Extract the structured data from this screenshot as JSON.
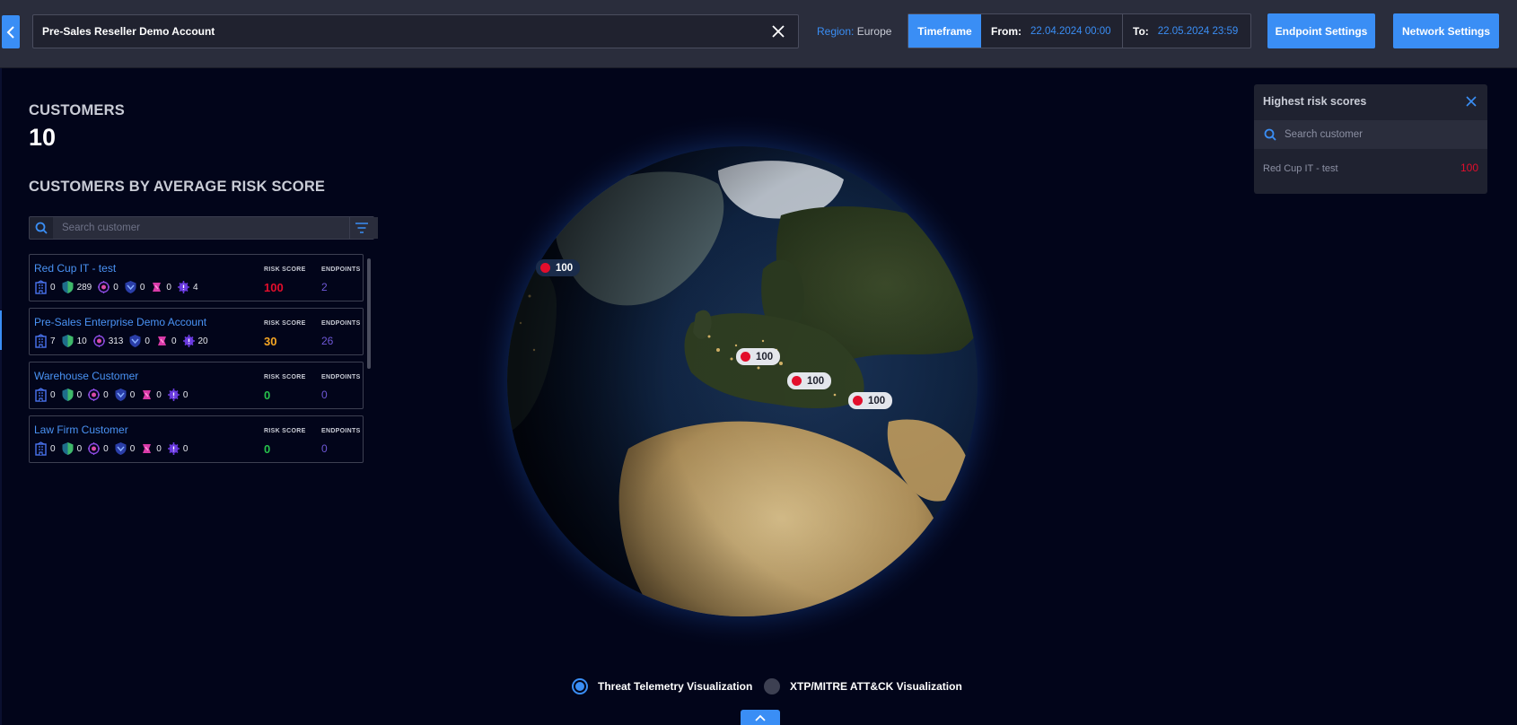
{
  "topbar": {
    "account_value": "Pre-Sales Reseller Demo Account",
    "region_label": "Region:",
    "region_value": "Europe",
    "timeframe_label": "Timeframe",
    "from_label": "From:",
    "from_value": "22.04.2024 00:00",
    "to_label": "To:",
    "to_value": "22.05.2024 23:59",
    "endpoint_settings": "Endpoint Settings",
    "network_settings": "Network Settings"
  },
  "summary": {
    "customers_label": "CUSTOMERS",
    "customers_count": "10",
    "avg_risk_label": "CUSTOMERS BY AVERAGE RISK SCORE"
  },
  "left_search": {
    "placeholder": "Search customer"
  },
  "customers": [
    {
      "name": "Red Cup IT - test",
      "risk_score_label": "RISK SCORE",
      "endpoints_label": "ENDPOINTS",
      "risk_score": "100",
      "risk_color": "#e30e2c",
      "endpoints": "2",
      "stats": [
        "0",
        "289",
        "0",
        "0",
        "0",
        "4"
      ]
    },
    {
      "name": "Pre-Sales Enterprise Demo Account",
      "risk_score_label": "RISK SCORE",
      "endpoints_label": "ENDPOINTS",
      "risk_score": "30",
      "risk_color": "#f5a623",
      "endpoints": "26",
      "stats": [
        "7",
        "10",
        "313",
        "0",
        "0",
        "20"
      ]
    },
    {
      "name": "Warehouse Customer",
      "risk_score_label": "RISK SCORE",
      "endpoints_label": "ENDPOINTS",
      "risk_score": "0",
      "risk_color": "#27c24c",
      "endpoints": "0",
      "stats": [
        "0",
        "0",
        "0",
        "0",
        "0",
        "0"
      ]
    },
    {
      "name": "Law Firm Customer",
      "risk_score_label": "RISK SCORE",
      "endpoints_label": "ENDPOINTS",
      "risk_score": "0",
      "risk_color": "#27c24c",
      "endpoints": "0",
      "stats": [
        "0",
        "0",
        "0",
        "0",
        "0",
        "0"
      ]
    }
  ],
  "stat_icons": [
    "building-icon",
    "shield-icon",
    "virus-icon",
    "network-shield-icon",
    "alert-badge-icon",
    "gear-alert-icon"
  ],
  "globe_pins": [
    {
      "value": "100",
      "style": "dark"
    },
    {
      "value": "100",
      "style": "light"
    },
    {
      "value": "100",
      "style": "light"
    },
    {
      "value": "100",
      "style": "light"
    }
  ],
  "risk_panel": {
    "title": "Highest risk scores",
    "search_placeholder": "Search customer",
    "rows": [
      {
        "name": "Red Cup IT - test",
        "score": "100"
      }
    ]
  },
  "visualization": {
    "option_1": "Threat Telemetry Visualization",
    "option_2": "XTP/MITRE ATT&CK Visualization",
    "selected": "option_1"
  },
  "colors": {
    "accent": "#3a8ef5",
    "critical": "#e30e2c",
    "medium": "#f5a623",
    "low": "#27c24c",
    "endpoints": "#6e58d6"
  }
}
